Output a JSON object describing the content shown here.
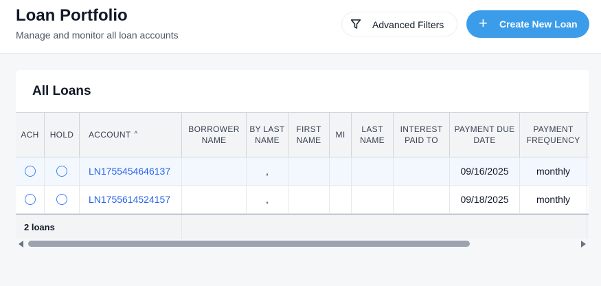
{
  "header": {
    "title": "Loan Portfolio",
    "subtitle": "Manage and monitor all loan accounts",
    "advanced_filters_label": "Advanced Filters",
    "create_label": "Create New Loan"
  },
  "panel": {
    "title": "All Loans"
  },
  "table": {
    "columns": {
      "ach": "ACH",
      "hold": "HOLD",
      "account": "ACCOUNT",
      "borrower_name": "BORROWER NAME",
      "by_last_name": "BY LAST NAME",
      "first_name": "FIRST NAME",
      "mi": "MI",
      "last_name": "LAST NAME",
      "interest_paid_to": "INTEREST PAID TO",
      "payment_due_date": "PAYMENT DUE DATE",
      "payment_frequency": "PAYMENT FREQUENCY"
    },
    "sort_indicator": "^",
    "rows": [
      {
        "account": "LN1755454646137",
        "borrower_name": "",
        "by_last_name": ",",
        "first_name": "",
        "mi": "",
        "last_name": "",
        "interest_paid_to": "",
        "payment_due_date": "09/16/2025",
        "payment_frequency": "monthly"
      },
      {
        "account": "LN1755614524157",
        "borrower_name": "",
        "by_last_name": ",",
        "first_name": "",
        "mi": "",
        "last_name": "",
        "interest_paid_to": "",
        "payment_due_date": "09/18/2025",
        "payment_frequency": "monthly"
      }
    ],
    "footer_count": "2 loans"
  },
  "icons": {
    "filter": "filter-funnel-icon",
    "plus": "plus-icon"
  },
  "colors": {
    "primary": "#3b9cea",
    "link": "#2563eb",
    "selected_row": "#f3f8ff"
  }
}
